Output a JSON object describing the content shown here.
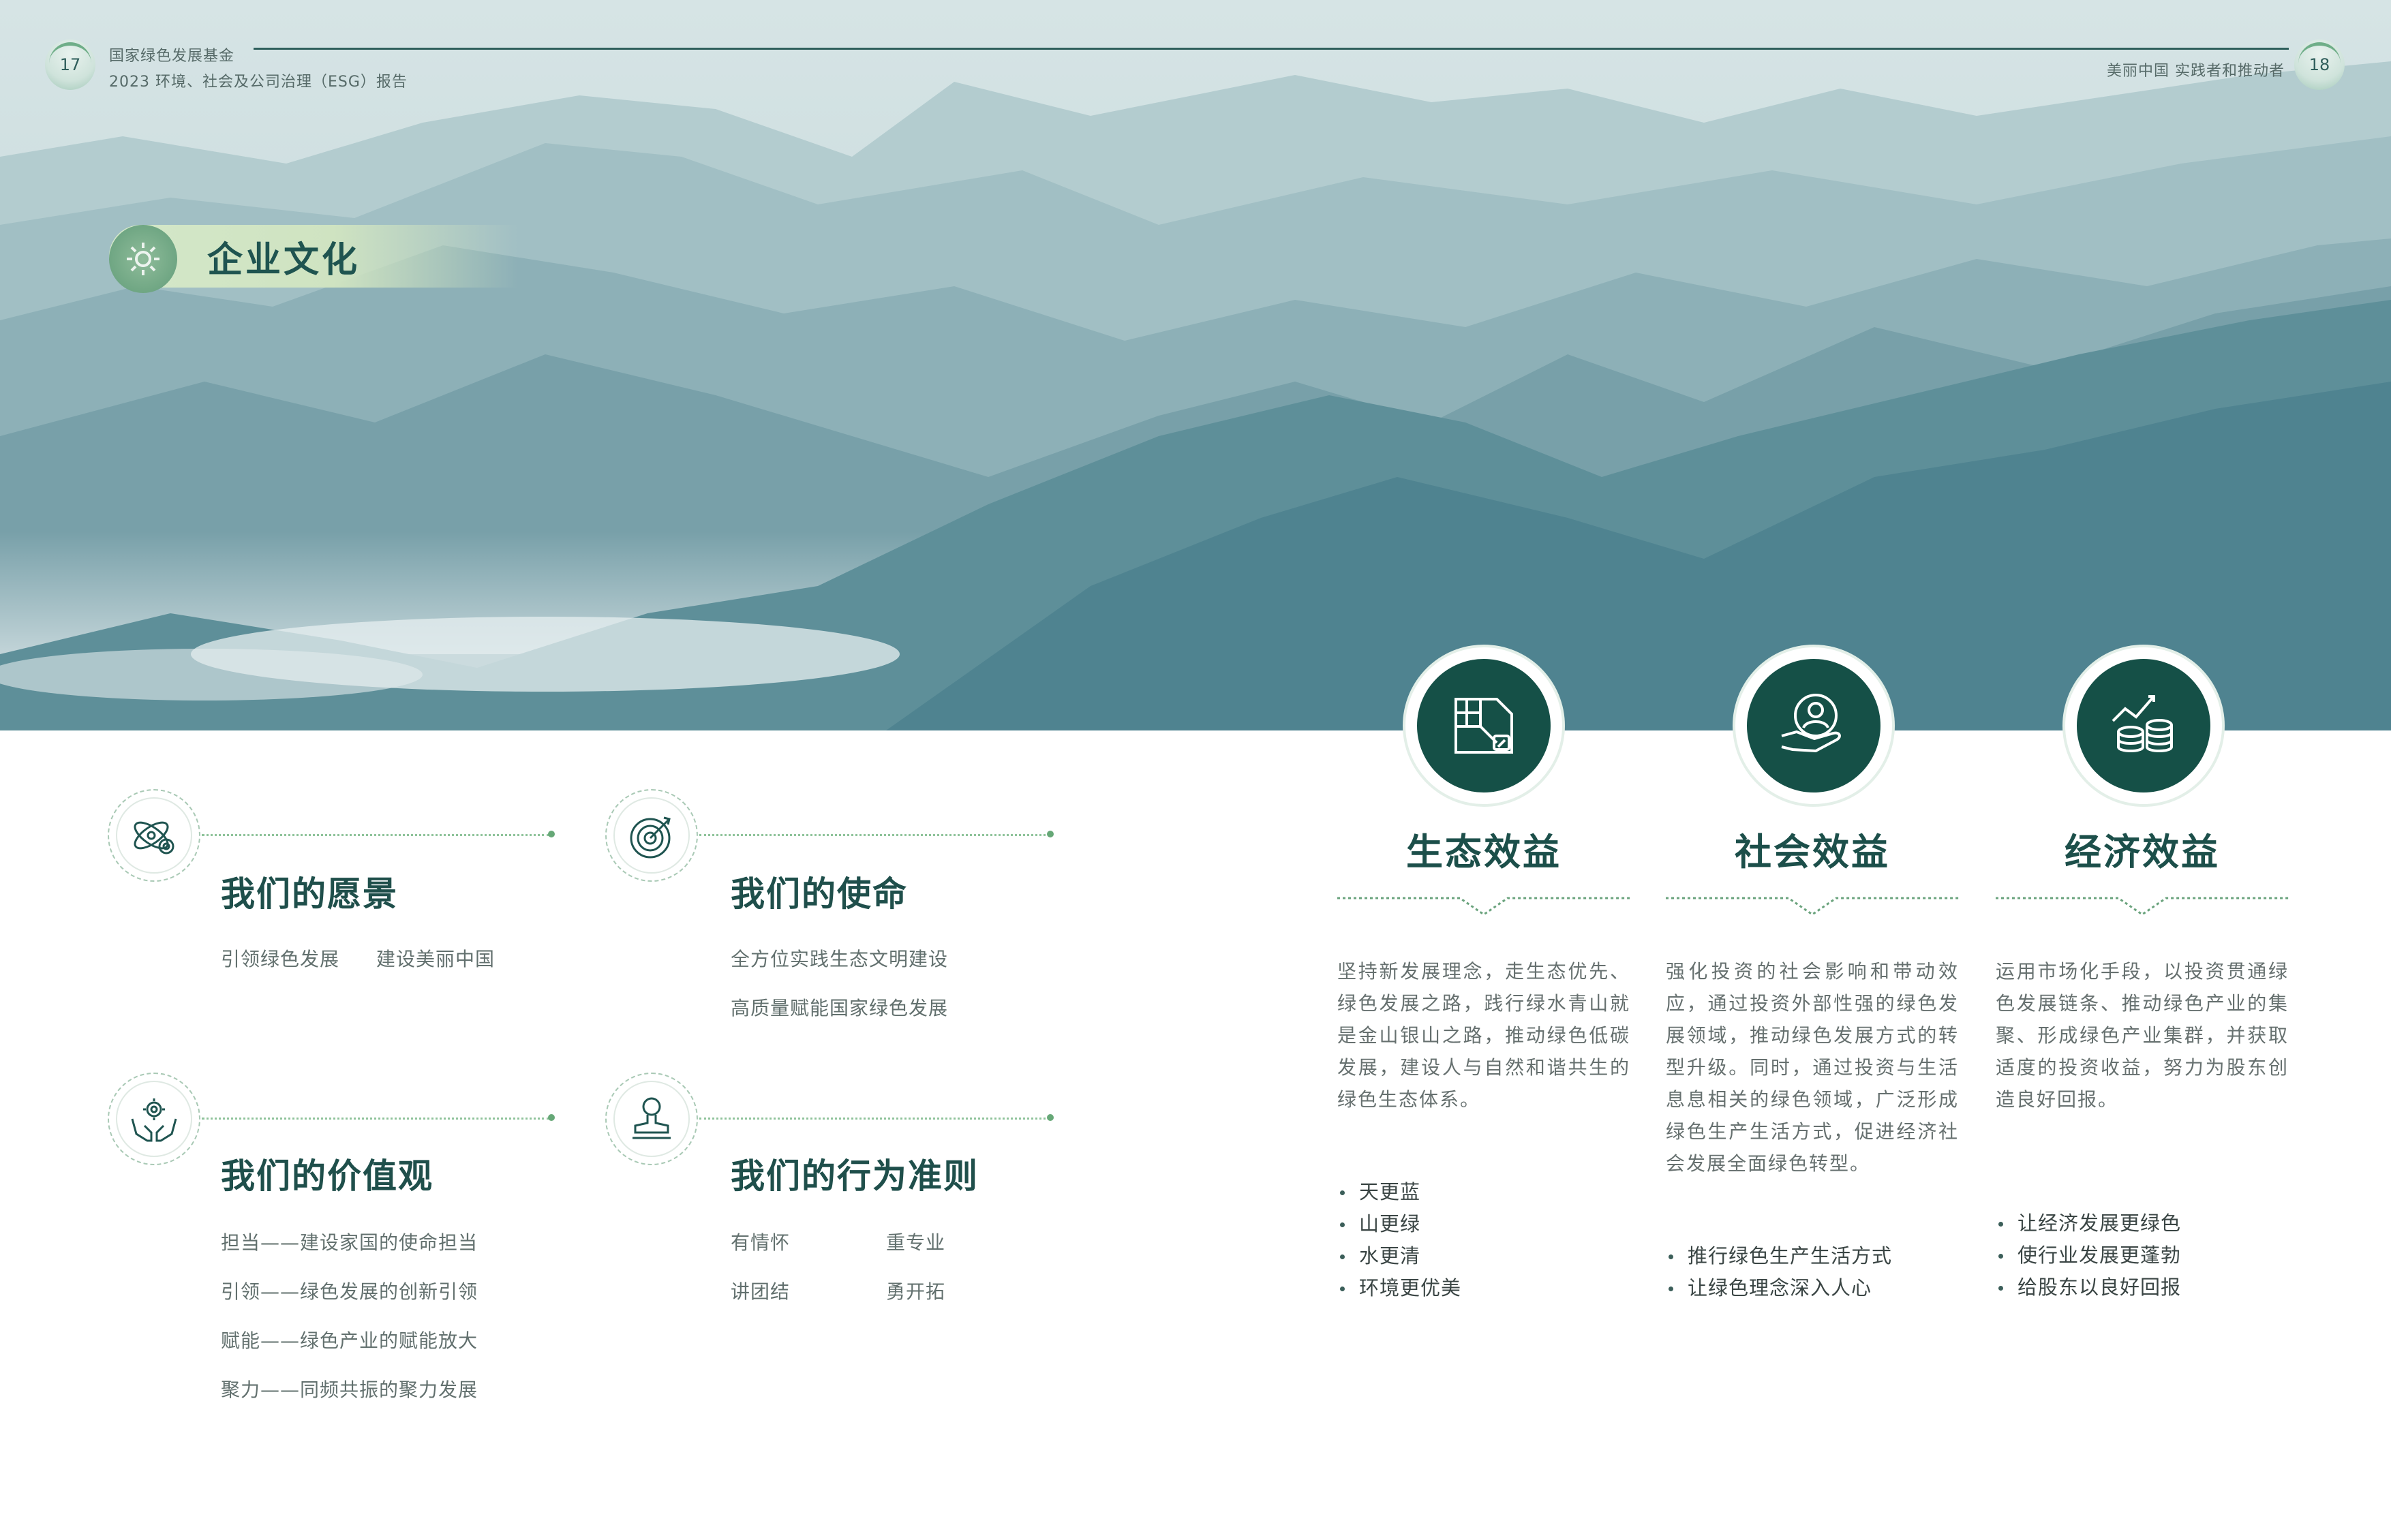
{
  "header": {
    "left_page_number": "17",
    "right_page_number": "18",
    "org_name": "国家绿色发展基金",
    "report_title": "2023 环境、社会及公司治理（ESG）报告",
    "right_tagline": "美丽中国 实践者和推动者"
  },
  "section": {
    "title": "企业文化"
  },
  "culture": {
    "vision": {
      "title": "我们的愿景",
      "lines": [
        "引领绿色发展",
        "建设美丽中国"
      ]
    },
    "mission": {
      "title": "我们的使命",
      "lines": [
        "全方位实践生态文明建设",
        "高质量赋能国家绿色发展"
      ]
    },
    "values": {
      "title": "我们的价值观",
      "lines": [
        "担当——建设家国的使命担当",
        "引领——绿色发展的创新引领",
        "赋能——绿色产业的赋能放大",
        "聚力——同频共振的聚力发展"
      ]
    },
    "conduct": {
      "title": "我们的行为准则",
      "lines": [
        "有情怀",
        "重专业",
        "讲团结",
        "勇开拓"
      ]
    }
  },
  "benefits": [
    {
      "title": "生态效益",
      "icon": "map-leaf-icon",
      "desc": "坚持新发展理念，走生态优先、绿色发展之路，践行绿水青山就是金山银山之路，推动绿色低碳发展，建设人与自然和谐共生的绿色生态体系。",
      "bullets": [
        "天更蓝",
        "山更绿",
        "水更清",
        "环境更优美"
      ]
    },
    {
      "title": "社会效益",
      "icon": "hand-people-icon",
      "desc": "强化投资的社会影响和带动效应，通过投资外部性强的绿色发展领域，推动绿色发展方式的转型升级。同时，通过投资与生活息息相关的绿色领域，广泛形成绿色生产生活方式，促进经济社会发展全面绿色转型。",
      "bullets": [
        "推行绿色生产生活方式",
        "让绿色理念深入人心"
      ]
    },
    {
      "title": "经济效益",
      "icon": "coins-growth-icon",
      "desc": "运用市场化手段，以投资贯通绿色发展链条、推动绿色产业的集聚、形成绿色产业集群，并获取适度的投资收益，努力为股东创造良好回报。",
      "bullets": [
        "让经济发展更绿色",
        "使行业发展更蓬勃",
        "给股东以良好回报"
      ]
    }
  ],
  "colors": {
    "primary_green": "#155047",
    "accent_green": "#66a877",
    "mountain_blue": "#5d93a0"
  }
}
